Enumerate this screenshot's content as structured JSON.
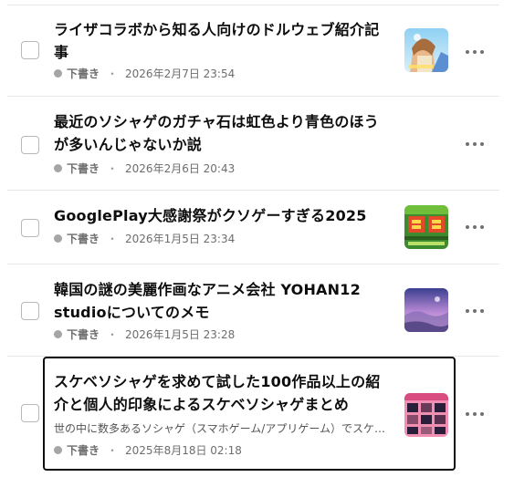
{
  "articles": [
    {
      "title": "ライザコラボから知る人向けのドルウェブ紹介記事",
      "excerpt": "",
      "status": "下書き",
      "date": "2026年2月7日 23:54",
      "thumbnail": "anime-girl-blue-sky-thumbnail"
    },
    {
      "title": "最近のソシャゲのガチャ石は虹色より青色のほうが多いんじゃないか説",
      "excerpt": "",
      "status": "下書き",
      "date": "2026年2月6日 20:43",
      "thumbnail": "none"
    },
    {
      "title": "GooglePlay大感謝祭がクソゲーすぎる2025",
      "excerpt": "",
      "status": "下書き",
      "date": "2026年1月5日 23:34",
      "thumbnail": "kansha-pixel-thumbnail"
    },
    {
      "title": "韓国の謎の美麗作画なアニメ会社 YOHAN12 studioについてのメモ",
      "excerpt": "",
      "status": "下書き",
      "date": "2026年1月5日 23:28",
      "thumbnail": "purple-sky-landscape-thumbnail"
    },
    {
      "title": "スケベソシャゲを求めて試した100作品以上の紹介と個人的印象によるスケベソシャゲまとめ",
      "excerpt": "世の中に数多あるソシャゲ（スマホゲーム/アプリゲーム）でスケ…",
      "status": "下書き",
      "date": "2025年8月18日 02:18",
      "thumbnail": "game-grid-pink-thumbnail"
    }
  ],
  "separator": "・"
}
